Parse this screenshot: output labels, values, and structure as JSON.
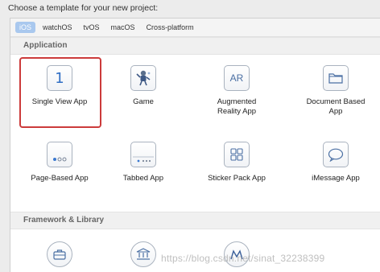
{
  "header": {
    "title": "Choose a template for your new project:"
  },
  "tabs": [
    {
      "label": "iOS",
      "selected": true
    },
    {
      "label": "watchOS",
      "selected": false
    },
    {
      "label": "tvOS",
      "selected": false
    },
    {
      "label": "macOS",
      "selected": false
    },
    {
      "label": "Cross-platform",
      "selected": false
    }
  ],
  "sections": {
    "application": {
      "title": "Application",
      "items": [
        {
          "label": "Single View App",
          "icon": "single-view-icon",
          "selected": true
        },
        {
          "label": "Game",
          "icon": "game-icon",
          "selected": false
        },
        {
          "label": "Augmented\nReality App",
          "icon": "ar-icon",
          "selected": false
        },
        {
          "label": "Document Based\nApp",
          "icon": "folder-icon",
          "selected": false
        },
        {
          "label": "Page-Based App",
          "icon": "page-dots-icon",
          "selected": false
        },
        {
          "label": "Tabbed App",
          "icon": "tabbed-icon",
          "selected": false
        },
        {
          "label": "Sticker Pack App",
          "icon": "sticker-grid-icon",
          "selected": false
        },
        {
          "label": "iMessage App",
          "icon": "message-bubble-icon",
          "selected": false
        }
      ]
    },
    "framework": {
      "title": "Framework & Library",
      "items": [
        {
          "label": "",
          "icon": "briefcase-icon"
        },
        {
          "label": "",
          "icon": "library-icon"
        },
        {
          "label": "",
          "icon": "metal-icon"
        }
      ]
    }
  },
  "watermark": "https://blog.csdn.net/sinat_32238399",
  "colors": {
    "selection_border": "#cc3b3b",
    "tab_selected_bg": "#a9c8ee"
  }
}
